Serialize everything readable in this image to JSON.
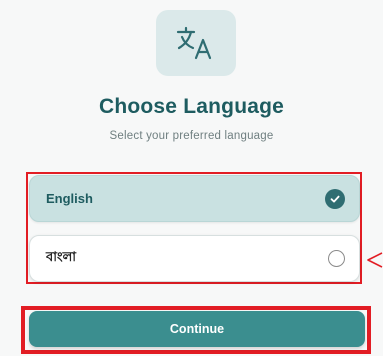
{
  "header": {
    "logo_icon": "translate-icon",
    "title": "Choose Language",
    "subtitle": "Select your preferred language"
  },
  "languages": [
    {
      "label": "English",
      "selected": true,
      "indicator_icon": "check-circle-icon"
    },
    {
      "label": "বাংলা",
      "selected": false,
      "indicator_icon": "radio-empty-icon"
    }
  ],
  "footer": {
    "continue_label": "Continue"
  },
  "annotation": {
    "highlight_color": "#e21d24",
    "pointer_icon": "arrow-left-icon"
  },
  "colors": {
    "accent": "#3b8e8f",
    "title": "#1e5c60",
    "selected_bg": "#c9e1e1"
  }
}
